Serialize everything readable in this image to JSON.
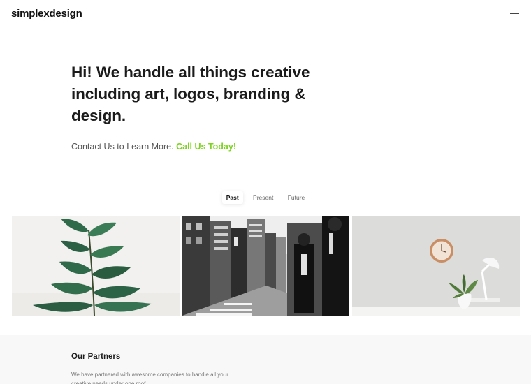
{
  "header": {
    "logo": "simplexdesign",
    "menu_icon": "hamburger-menu-icon"
  },
  "hero": {
    "title": "Hi! We handle all things creative including art, logos, branding & design.",
    "subtitle_prefix": "Contact Us to Learn More.",
    "cta": "Call Us Today!",
    "cta_color": "#7ed321"
  },
  "tabs": [
    {
      "label": "Past",
      "active": true
    },
    {
      "label": "Present",
      "active": false
    },
    {
      "label": "Future",
      "active": false
    }
  ],
  "gallery": [
    {
      "name": "plant-photo",
      "description_icon": "plant-image"
    },
    {
      "name": "street-photo",
      "description_icon": "city-street-image"
    },
    {
      "name": "desk-photo",
      "description_icon": "desk-clock-lamp-image"
    }
  ],
  "partners": {
    "title": "Our Partners",
    "text": "We have partnered with awesome companies to handle all your creative needs under one roof."
  }
}
